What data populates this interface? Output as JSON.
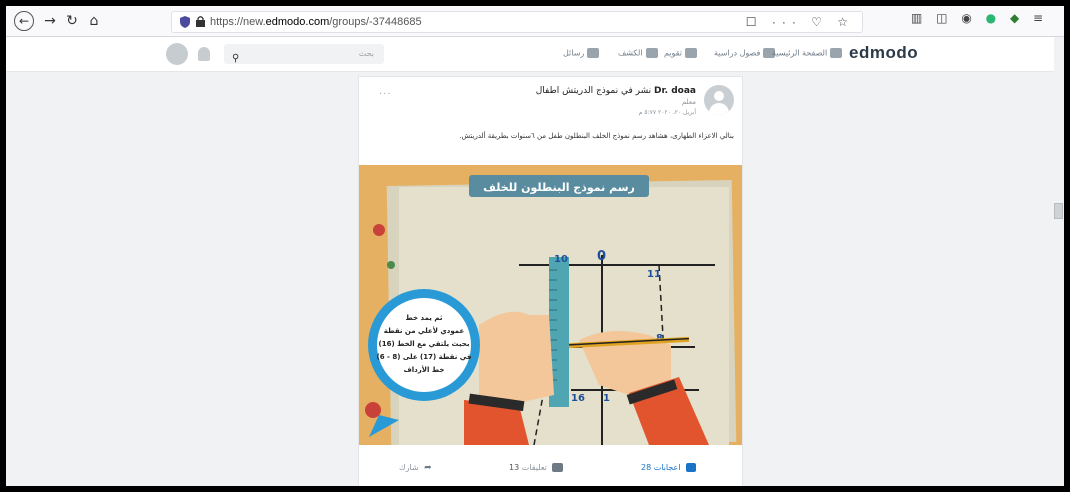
{
  "browser": {
    "url_prefix": "https://new.",
    "url_domain": "edmodo.com",
    "url_path": "/groups/-37448685",
    "url_icons": "☐ ··· ♡ ☆"
  },
  "header": {
    "logo": "edmodo",
    "nav": {
      "home": "الصفحة الرئيسية",
      "classes": "فصول دراسية",
      "calendar": "تقويم",
      "discover": "الكشف",
      "messages": "رسائل"
    },
    "search_placeholder": "بحث"
  },
  "post": {
    "author": "Dr. doaa",
    "author_suffix": "نشر في نموذج الدريتش اطفال",
    "role": "معلم",
    "date": "أبريل ٢٠، ٢٠٢٠ ٥:٧٧ م",
    "menu": "···",
    "text": "بنالي الاعزاء الطهارى، هشاهد رسم نموذج الخلف البنطلون طفل من ٦سنوات بطريقة ألدريتش.",
    "image": {
      "title": "رسم نموذج البنطلون للخلف",
      "bubble_lines": [
        "ثم يمد خط",
        "عمودي لأعلي من نقطة",
        "(16) بحيث يلتقي مع الخط",
        "(6 - 8) في نقطة (17) على",
        "خط الأرداف"
      ],
      "labels": {
        "l10": "10",
        "l0": "0",
        "l11": "11",
        "l8": "8",
        "l16": "16",
        "l1": "1"
      }
    },
    "actions": {
      "likes_count": "28",
      "likes_label": "اعجابات",
      "comments_count": "13",
      "comments_label": "تعليقات",
      "share_label": "شارك"
    }
  }
}
